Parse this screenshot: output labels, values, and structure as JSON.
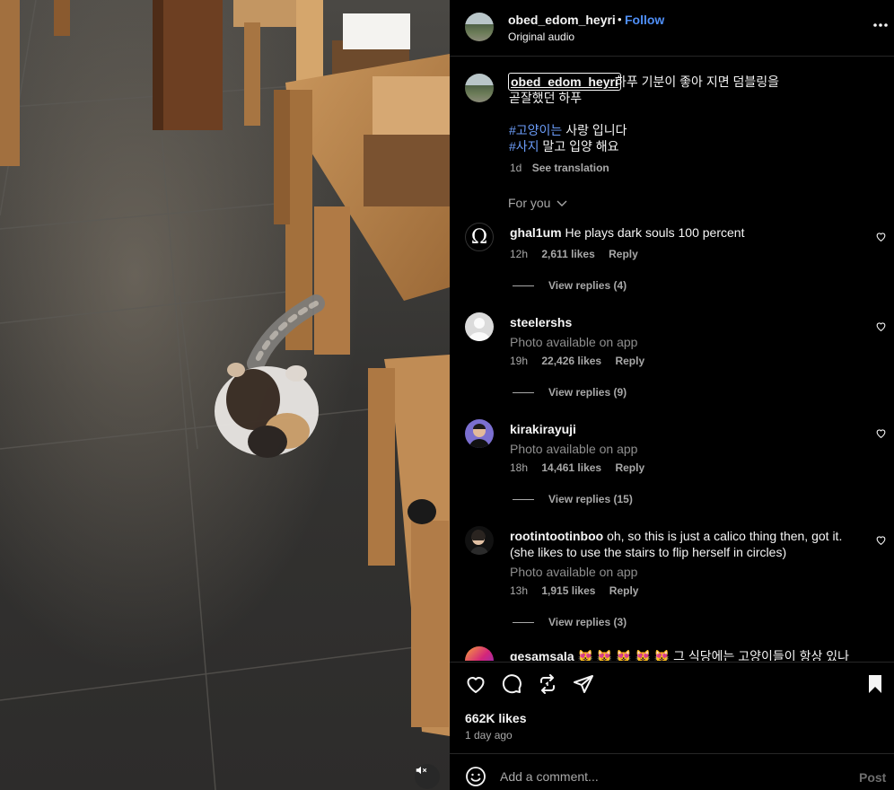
{
  "header": {
    "username": "obed_edom_heyri",
    "separator": "•",
    "follow_label": "Follow",
    "audio_label": "Original audio",
    "more_icon": "more-horizontal-icon"
  },
  "caption": {
    "username": "obed_edom_heyri",
    "line1": "하푸 기분이 좋아 지면 덤블링을",
    "line2": "곧잘했던 하푸",
    "tag1": "#고양이는",
    "tag1_rest": " 사랑 입니다",
    "tag2": "#사지",
    "tag2_rest": " 말고 입양 해요",
    "time": "1d",
    "see_translation": "See translation"
  },
  "for_you_label": "For you",
  "comments": [
    {
      "username": "ghal1um",
      "text": "He plays dark souls 100 percent",
      "photo": "",
      "time": "12h",
      "likes": "2,611 likes",
      "reply": "Reply",
      "view_replies": "View replies (4)"
    },
    {
      "username": "steelershs",
      "text": "",
      "photo": "Photo available on app",
      "time": "19h",
      "likes": "22,426 likes",
      "reply": "Reply",
      "view_replies": "View replies (9)"
    },
    {
      "username": "kirakirayuji",
      "text": "",
      "photo": "Photo available on app",
      "time": "18h",
      "likes": "14,461 likes",
      "reply": "Reply",
      "view_replies": "View replies (15)"
    },
    {
      "username": "rootintootinboo",
      "text": "oh, so this is just a calico thing then, got it. (she likes to use the stairs to flip herself in circles)",
      "photo": "Photo available on app",
      "time": "13h",
      "likes": "1,915 likes",
      "reply": "Reply",
      "view_replies": "View replies (3)"
    },
    {
      "username": "gesamsala",
      "text": "😻 😻 😻 😻 😻  그 식당에는 고양이들이 항상 있나",
      "photo": "",
      "time": "",
      "likes": "",
      "reply": "",
      "view_replies": ""
    }
  ],
  "footer": {
    "likes": "662K likes",
    "posted": "1 day ago",
    "add_comment_placeholder": "Add a comment...",
    "post_label": "Post"
  },
  "colors": {
    "accent": "#4f8ff7",
    "hashtag": "#6b9cf8",
    "background": "#000000",
    "muted": "#a8a8a8"
  }
}
